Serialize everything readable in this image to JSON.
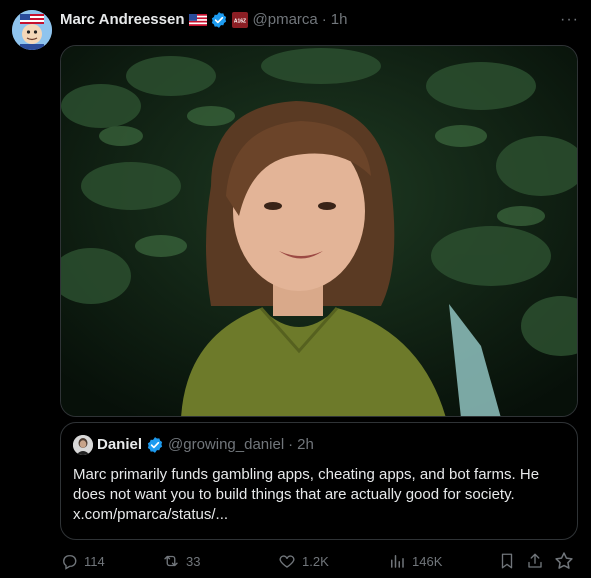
{
  "tweet": {
    "author_name": "Marc Andreessen",
    "handle": "@pmarca",
    "separator": "·",
    "time": "1h",
    "more": "···",
    "affiliation_badge": "A16Z"
  },
  "quote": {
    "name": "Daniel",
    "handle": "@growing_daniel",
    "separator": "·",
    "time": "2h",
    "text_line1": "Marc primarily funds gambling apps, cheating apps, and bot farms. He",
    "text_line2": "does not want you to build things that are actually good for society.",
    "link": "x.com/pmarca/status/..."
  },
  "actions": {
    "replies": "114",
    "reposts": "33",
    "likes": "1.2K",
    "views": "146K"
  },
  "colors": {
    "background": "#000000",
    "text": "#e7e9ea",
    "muted": "#71767b",
    "border": "#2f3336",
    "verified": "#1d9bf0"
  }
}
